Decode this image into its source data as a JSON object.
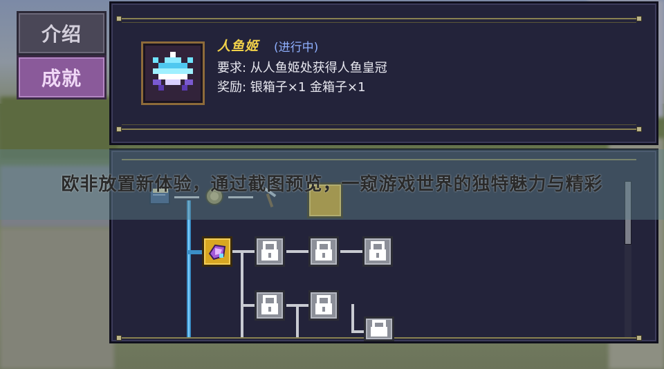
{
  "tabs": [
    {
      "label": "介绍",
      "active": false
    },
    {
      "label": "成就",
      "active": true
    }
  ],
  "quest": {
    "title": "人鱼姬",
    "status": "(进行中)",
    "requirement": "要求: 从人鱼姬处获得人鱼皇冠",
    "reward": "奖励: 银箱子×1 金箱子×1",
    "icon": "mermaid-crown-icon"
  },
  "tree": {
    "category_icons": [
      "book-icon",
      "coin-icon",
      "pickaxe-icon",
      "selected-category-icon"
    ],
    "nodes": [
      {
        "state": "completed",
        "icon": "amethyst-icon"
      },
      {
        "state": "locked",
        "icon": "padlock-icon"
      },
      {
        "state": "locked",
        "icon": "padlock-icon"
      },
      {
        "state": "locked",
        "icon": "padlock-icon"
      },
      {
        "state": "locked",
        "icon": "padlock-icon"
      },
      {
        "state": "locked",
        "icon": "padlock-icon"
      },
      {
        "state": "locked",
        "icon": "padlock-icon"
      }
    ]
  },
  "caption": "欧非放置新体验，通过截图预览，一窥游戏世界的独特魅力与精彩",
  "colors": {
    "title_gold": "#f2d24a",
    "status_blue": "#8fb0ff",
    "panel_bg": "#23233a",
    "active_tab": "#8a5a9a",
    "completed_node": "#d8a722",
    "locked_node": "#8c8f98",
    "progress_line": "#3b8fc8"
  }
}
